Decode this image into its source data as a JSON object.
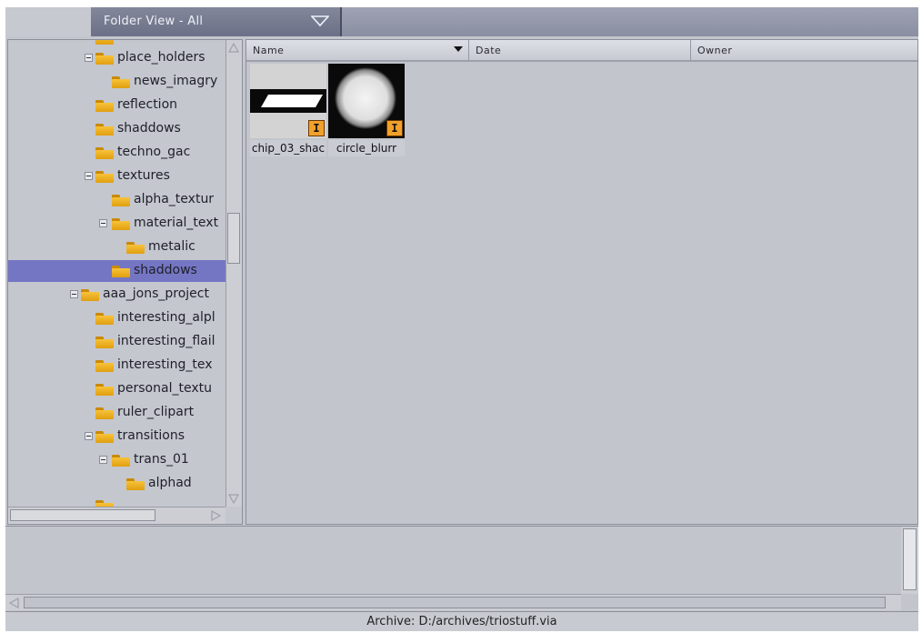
{
  "header": {
    "folder_view_label": "Folder View - All"
  },
  "tree": {
    "items": [
      {
        "label": "",
        "partial": true
      },
      {
        "label": "place_holders"
      },
      {
        "label": "news_imagry"
      },
      {
        "label": "reflection"
      },
      {
        "label": "shaddows"
      },
      {
        "label": "techno_gac"
      },
      {
        "label": "textures"
      },
      {
        "label": "alpha_textur"
      },
      {
        "label": "material_text"
      },
      {
        "label": "metalic"
      },
      {
        "label": "shaddows",
        "selected": true
      },
      {
        "label": "aaa_jons_project"
      },
      {
        "label": "interesting_alpl"
      },
      {
        "label": "interesting_flail"
      },
      {
        "label": "interesting_tex"
      },
      {
        "label": "personal_textu"
      },
      {
        "label": "ruler_clipart"
      },
      {
        "label": "transitions"
      },
      {
        "label": "trans_01"
      },
      {
        "label": "alphad"
      },
      {
        "label": "",
        "partial": true
      }
    ]
  },
  "file_list": {
    "columns": [
      "Name",
      "Date",
      "Owner"
    ],
    "items": [
      {
        "caption": "chip_03_shac",
        "badge": "I",
        "preview": "chip"
      },
      {
        "caption": "circle_blurr",
        "badge": "I",
        "preview": "circle"
      }
    ]
  },
  "status": {
    "archive_text": "Archive: D:/archives/triostuff.via"
  },
  "colors": {
    "selection": "#7476c4",
    "folder": "#f0b526",
    "badge": "#f1a12b"
  }
}
